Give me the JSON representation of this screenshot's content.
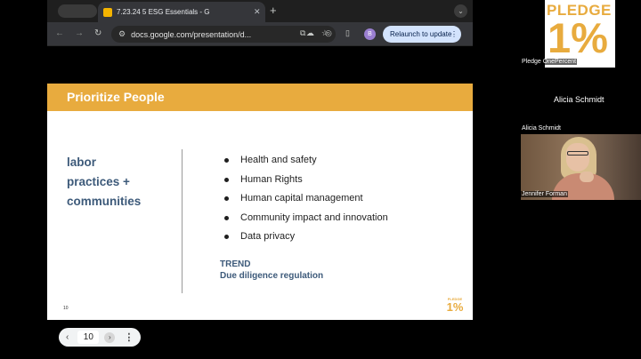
{
  "browser": {
    "tab_title": "7.23.24 5 ESG Essentials - G",
    "tab_close": "✕",
    "new_tab": "+",
    "tab_menu": "⌄",
    "nav_back": "←",
    "nav_forward": "→",
    "nav_reload": "↻",
    "url": "docs.google.com/presentation/d...",
    "omni_info_icon": "⚙",
    "relaunch_label": "Relaunch to update",
    "relaunch_menu": "⋮",
    "profile_initial": "B"
  },
  "slide": {
    "title": "Prioritize People",
    "left_heading": [
      "labor",
      "practices +",
      "communities"
    ],
    "bullets": [
      "Health and safety",
      "Human Rights",
      "Human capital management",
      "Community impact and innovation",
      "Data privacy"
    ],
    "trend_label": "TREND",
    "trend_text": "Due diligence regulation",
    "page_number": "10",
    "logo_small": "PLEDGE",
    "logo_big": "1%"
  },
  "pager": {
    "prev": "‹",
    "current": "10",
    "next": "›",
    "more": "⋮"
  },
  "participants": {
    "logo_top": "PLEDGE",
    "logo_big": "1%",
    "pledge_name": "Pledge OnePercent",
    "center_name": "Alicia Schmidt",
    "alicia_label": "Alicia Schmidt",
    "jennifer_label": "Jennifer Forman"
  },
  "colors": {
    "accent": "#e8ab3e",
    "heading_blue": "#3d5a7a"
  }
}
